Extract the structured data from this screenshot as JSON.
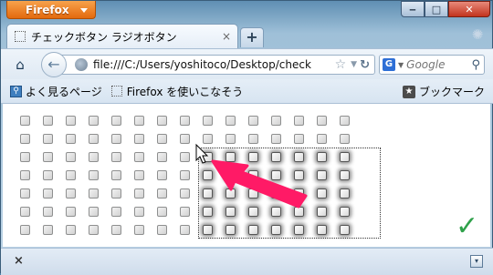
{
  "window": {
    "app_button_label": "Firefox",
    "min_label": "‒",
    "max_label": "□",
    "close_label": "✕"
  },
  "tab": {
    "title": "チェックボタン ラジオボタン",
    "close_glyph": "×",
    "new_tab_glyph": "+"
  },
  "navbar": {
    "url": "file:///C:/Users/yoshitoco/Desktop/check",
    "search_placeholder": "Google",
    "search_engine_icon": "G"
  },
  "bookmarks": {
    "items": [
      {
        "label": "よく見るページ",
        "icon": "bookmark-folder-icon"
      },
      {
        "label": "Firefox を使いこなそう",
        "icon": "page-icon"
      }
    ],
    "menu_label": "ブックマーク"
  },
  "page": {
    "rows": 7,
    "cols": 15,
    "shadowed_cols": [
      8,
      9,
      10,
      11,
      12,
      13,
      14
    ],
    "shadowed_rows": [
      2,
      3,
      4,
      5,
      6
    ],
    "checkmark": "✓"
  },
  "statusbar": {
    "close_glyph": "×"
  },
  "colors": {
    "arrow": "#ff1a66",
    "checkmark": "#2fa14a",
    "firefox_button": "#e36a0e"
  }
}
